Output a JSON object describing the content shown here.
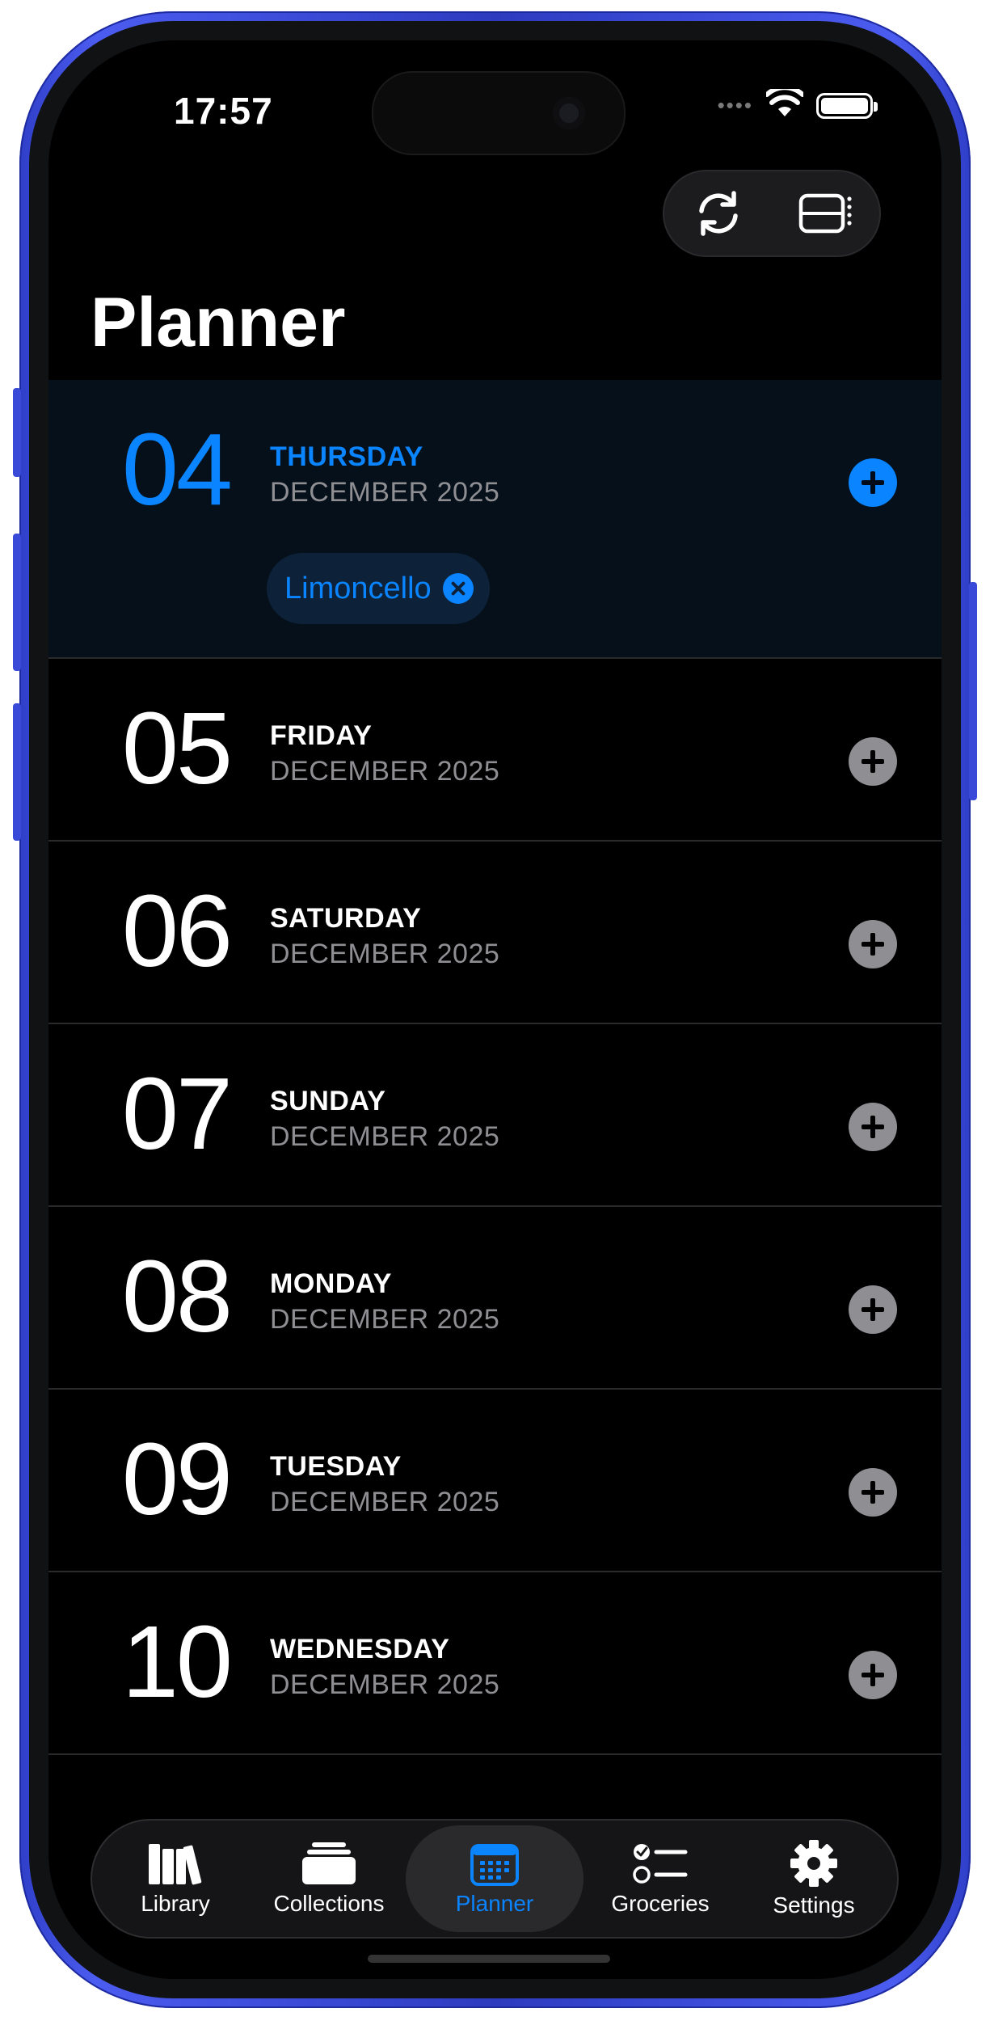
{
  "status_bar": {
    "time": "17:57",
    "signal": "••••"
  },
  "toolbar": {
    "buttons": [
      "refresh-icon",
      "calendar-settings-icon"
    ]
  },
  "page": {
    "title": "Planner"
  },
  "days": [
    {
      "number": "04",
      "weekday": "THURSDAY",
      "month": "DECEMBER 2025",
      "selected": true,
      "meals": [
        "Limoncello"
      ]
    },
    {
      "number": "05",
      "weekday": "FRIDAY",
      "month": "DECEMBER 2025",
      "selected": false,
      "meals": []
    },
    {
      "number": "06",
      "weekday": "SATURDAY",
      "month": "DECEMBER 2025",
      "selected": false,
      "meals": []
    },
    {
      "number": "07",
      "weekday": "SUNDAY",
      "month": "DECEMBER 2025",
      "selected": false,
      "meals": []
    },
    {
      "number": "08",
      "weekday": "MONDAY",
      "month": "DECEMBER 2025",
      "selected": false,
      "meals": []
    },
    {
      "number": "09",
      "weekday": "TUESDAY",
      "month": "DECEMBER 2025",
      "selected": false,
      "meals": []
    },
    {
      "number": "10",
      "weekday": "WEDNESDAY",
      "month": "DECEMBER 2025",
      "selected": false,
      "meals": []
    }
  ],
  "tabbar": {
    "tabs": [
      {
        "label": "Library",
        "icon": "books-icon",
        "active": false
      },
      {
        "label": "Collections",
        "icon": "collections-icon",
        "active": false
      },
      {
        "label": "Planner",
        "icon": "calendar-icon",
        "active": true
      },
      {
        "label": "Groceries",
        "icon": "checklist-icon",
        "active": false
      },
      {
        "label": "Settings",
        "icon": "gear-icon",
        "active": false
      }
    ]
  },
  "colors": {
    "accent": "#0a84ff",
    "background": "#000000",
    "secondary_text": "#8e8e93",
    "frame": "#3446d6"
  }
}
